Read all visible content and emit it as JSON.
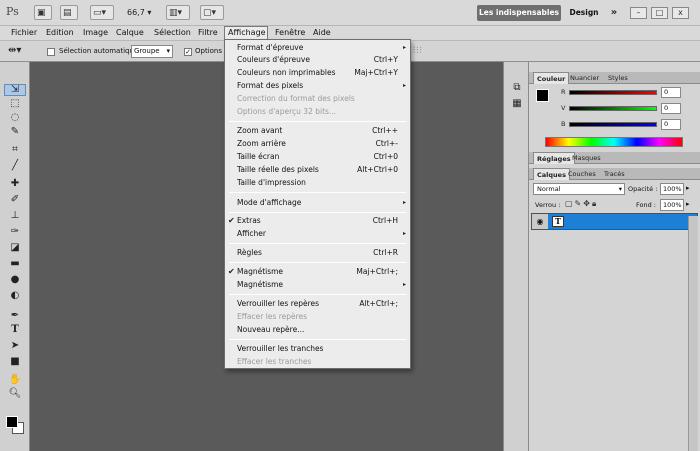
{
  "appbar": {
    "logo": "Ps",
    "zoom": "66,7",
    "workspace_active": "Les indispensables",
    "workspace_other": "Design",
    "more": "»",
    "win_min": "–",
    "win_max": "□",
    "win_close": "x"
  },
  "menubar": {
    "items": [
      "Fichier",
      "Edition",
      "Image",
      "Calque",
      "Sélection",
      "Filtre",
      "Affichage",
      "Fenêtre",
      "Aide"
    ]
  },
  "options": {
    "auto_select_label": "Sélection automatique :",
    "auto_select_value": "Groupe",
    "transform_label": "Options d"
  },
  "dropdown": {
    "items": [
      {
        "label": "Format d'épreuve",
        "shortcut": "",
        "arrow": "▸"
      },
      {
        "label": "Couleurs d'épreuve",
        "shortcut": "Ctrl+Y"
      },
      {
        "label": "Couleurs non imprimables",
        "shortcut": "Maj+Ctrl+Y"
      },
      {
        "label": "Format des pixels",
        "shortcut": "",
        "arrow": "▸"
      },
      {
        "label": "Correction du format des pixels",
        "shortcut": ""
      },
      {
        "label": "Options d'aperçu 32 bits...",
        "shortcut": ""
      },
      {
        "label": "Zoom avant",
        "shortcut": "Ctrl++"
      },
      {
        "label": "Zoom arrière",
        "shortcut": "Ctrl+-"
      },
      {
        "label": "Taille écran",
        "shortcut": "Ctrl+0"
      },
      {
        "label": "Taille réelle des pixels",
        "shortcut": "Alt+Ctrl+0"
      },
      {
        "label": "Taille d'impression",
        "shortcut": ""
      },
      {
        "label": "Mode d'affichage",
        "shortcut": "",
        "arrow": "▸"
      },
      {
        "label": "Extras",
        "shortcut": "Ctrl+H",
        "check": "✔"
      },
      {
        "label": "Afficher",
        "shortcut": "",
        "arrow": "▸"
      },
      {
        "label": "Règles",
        "shortcut": "Ctrl+R"
      },
      {
        "label": "Magnétisme",
        "shortcut": "Maj+Ctrl+;",
        "check": "✔"
      },
      {
        "label": "Magnétisme",
        "shortcut": "",
        "arrow": "▸"
      },
      {
        "label": "Verrouiller les repères",
        "shortcut": "Alt+Ctrl+;"
      },
      {
        "label": "Effacer les repères",
        "shortcut": ""
      },
      {
        "label": "Nouveau repère...",
        "shortcut": ""
      },
      {
        "label": "Verrouiller les tranches",
        "shortcut": ""
      },
      {
        "label": "Effacer les tranches",
        "shortcut": ""
      }
    ]
  },
  "color_panel": {
    "tabs": [
      "Couleur",
      "Nuancier",
      "Styles"
    ],
    "channels": [
      {
        "label": "R",
        "value": "0"
      },
      {
        "label": "V",
        "value": "0"
      },
      {
        "label": "B",
        "value": "0"
      }
    ]
  },
  "adjust_panel": {
    "tabs": [
      "Réglages",
      "Masques"
    ]
  },
  "layers_panel": {
    "tabs": [
      "Calques",
      "Couches",
      "Tracés"
    ],
    "blend_mode": "Normal",
    "opacity_label": "Opacité :",
    "opacity_value": "100%",
    "lock_label": "Verrou :",
    "fill_label": "Fond :",
    "fill_value": "100%",
    "layer_thumb": "T"
  },
  "colors": {
    "accent": "#1e7fd6",
    "workspace_active_bg": "#6f6f6f",
    "canvas": "#5a5a5a"
  },
  "tool_icons": [
    "move-icon",
    "marquee-icon",
    "lasso-icon",
    "quick-select-icon",
    "crop-icon",
    "eyedropper-icon",
    "healing-icon",
    "brush-icon",
    "clone-stamp-icon",
    "history-brush-icon",
    "eraser-icon",
    "gradient-icon",
    "blur-icon",
    "dodge-icon",
    "pen-icon",
    "type-icon",
    "path-select-icon",
    "shape-icon",
    "hand-icon",
    "zoom-icon"
  ]
}
